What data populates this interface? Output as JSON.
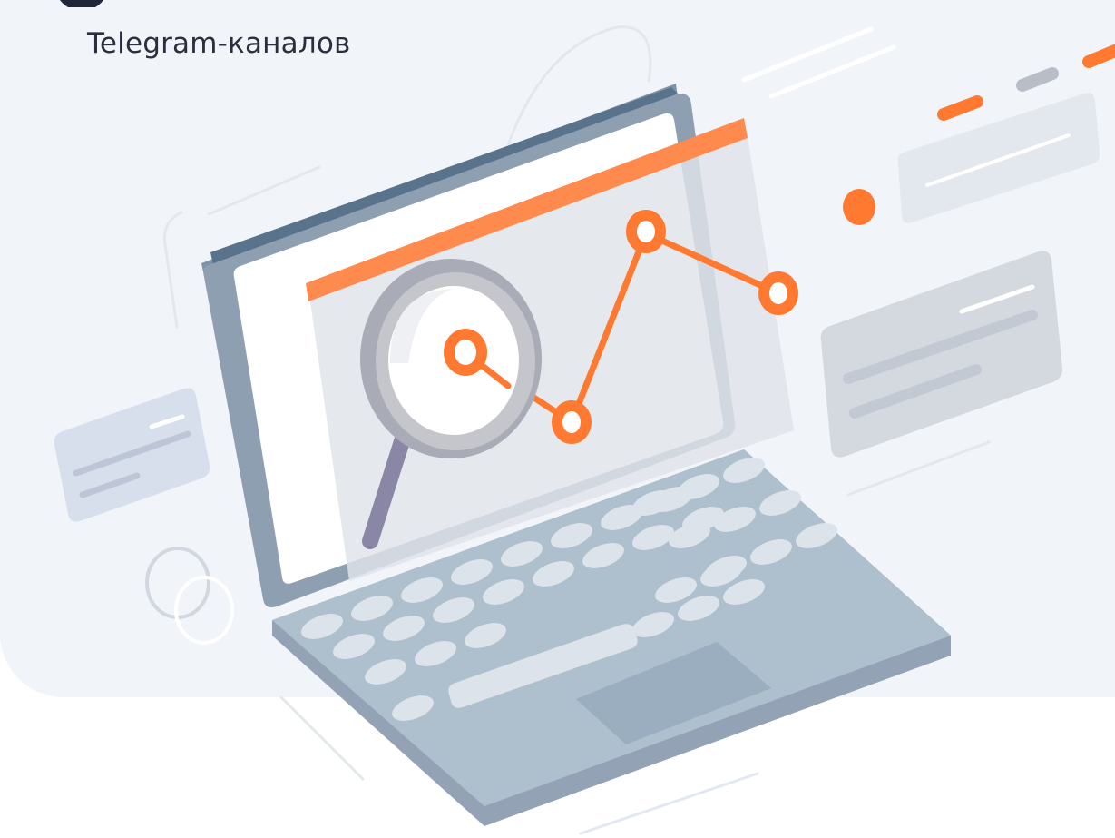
{
  "header": {
    "subtitle": "Telegram-каналов"
  },
  "illustration": {
    "chart_points": 4,
    "colors": {
      "accent": "#ff7a30",
      "laptop_frame": "#8e9fb2",
      "laptop_frame_dark": "#5a738c",
      "keyboard": "#aebfcd",
      "key": "#dce3ea",
      "background_panel": "#f1f4f9"
    }
  }
}
